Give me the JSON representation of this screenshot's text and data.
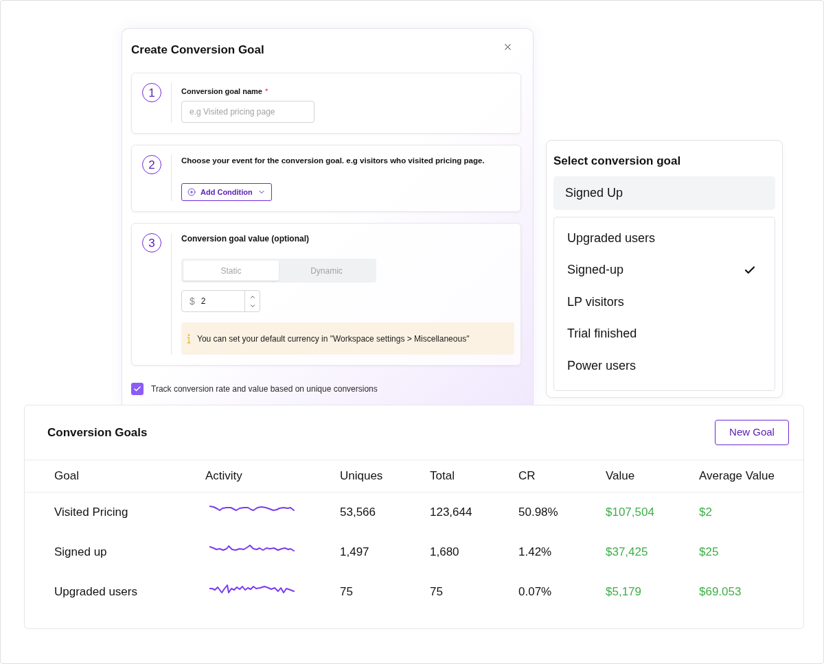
{
  "modal": {
    "title": "Create Conversion Goal",
    "steps": [
      {
        "kind": "name",
        "number": "1",
        "label": "Conversion goal name",
        "required_mark": "*",
        "placeholder": "e.g Visited pricing page"
      },
      {
        "kind": "event",
        "number": "2",
        "text": "Choose your event for the conversion goal. e.g visitors who visited pricing page.",
        "button": "Add Condition"
      },
      {
        "kind": "value",
        "number": "3",
        "label": "Conversion goal value (optional)",
        "segments": [
          {
            "label": "Static",
            "selected": true
          },
          {
            "label": "Dynamic",
            "selected": false
          }
        ],
        "currency": "$",
        "amount": "2",
        "info": "You can set your default currency in \"Workspace settings > Miscellaneous\""
      }
    ],
    "checkbox": {
      "label": "Track conversion rate and value based on unique conversions",
      "checked": true
    }
  },
  "select_panel": {
    "title": "Select conversion goal",
    "value": "Signed Up",
    "options": [
      {
        "label": "Upgraded users",
        "selected": false
      },
      {
        "label": "Signed-up",
        "selected": true
      },
      {
        "label": "LP visitors",
        "selected": false
      },
      {
        "label": "Trial finished",
        "selected": false
      },
      {
        "label": "Power users",
        "selected": false
      }
    ]
  },
  "goals_table": {
    "title": "Conversion Goals",
    "button": "New Goal",
    "columns": [
      "Goal",
      "Activity",
      "Uniques",
      "Total",
      "CR",
      "Value",
      "Average Value"
    ],
    "rows": [
      {
        "goal": "Visited Pricing",
        "uniques": "53,566",
        "total": "123,644",
        "cr": "50.98%",
        "value": "$107,504",
        "average_value": "$2"
      },
      {
        "goal": "Signed up",
        "uniques": "1,497",
        "total": "1,680",
        "cr": "1.42%",
        "value": "$37,425",
        "average_value": "$25"
      },
      {
        "goal": "Upgraded users",
        "uniques": "75",
        "total": "75",
        "cr": "0.07%",
        "value": "$5,179",
        "average_value": "$69.053"
      }
    ]
  }
}
